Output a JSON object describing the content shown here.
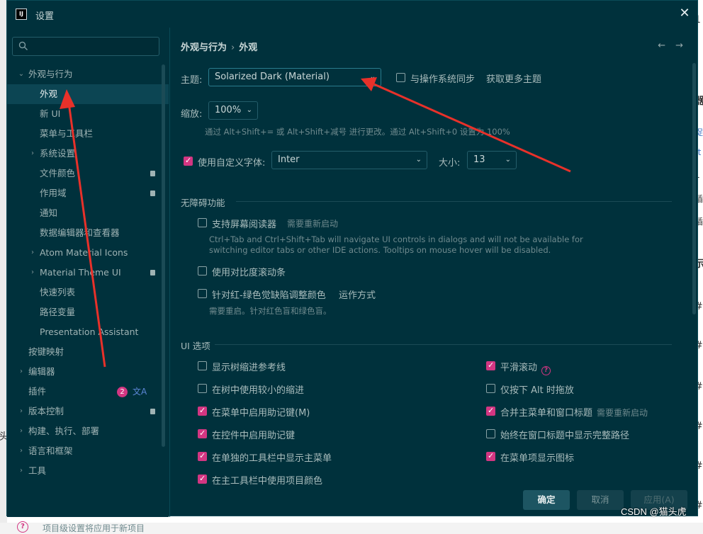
{
  "window": {
    "title": "设置",
    "app_icon_text": "IJ"
  },
  "search": {
    "placeholder": "",
    "icon": "search-icon"
  },
  "sidebar": {
    "items": [
      {
        "label": "外观与行为",
        "level": 0,
        "chevron": "expanded"
      },
      {
        "label": "外观",
        "level": 1,
        "selected": true
      },
      {
        "label": "新 UI",
        "level": 1
      },
      {
        "label": "菜单与工具栏",
        "level": 1
      },
      {
        "label": "系统设置",
        "level": 1,
        "chevron": "collapsed"
      },
      {
        "label": "文件颜色",
        "level": 1,
        "project_icon": true
      },
      {
        "label": "作用域",
        "level": 1,
        "project_icon": true
      },
      {
        "label": "通知",
        "level": 1
      },
      {
        "label": "数据编辑器和查看器",
        "level": 1
      },
      {
        "label": "Atom Material Icons",
        "level": 1,
        "chevron": "collapsed"
      },
      {
        "label": "Material Theme UI",
        "level": 1,
        "chevron": "collapsed",
        "project_icon": true
      },
      {
        "label": "快速列表",
        "level": 1
      },
      {
        "label": "路径变量",
        "level": 1
      },
      {
        "label": "Presentation Assistant",
        "level": 1
      },
      {
        "label": "按键映射",
        "level": 0
      },
      {
        "label": "编辑器",
        "level": 0,
        "chevron": "collapsed"
      },
      {
        "label": "插件",
        "level": 0,
        "badge": "2",
        "translate_icon": "文A"
      },
      {
        "label": "版本控制",
        "level": 0,
        "chevron": "collapsed",
        "project_icon": true
      },
      {
        "label": "构建、执行、部署",
        "level": 0,
        "chevron": "collapsed"
      },
      {
        "label": "语言和框架",
        "level": 0,
        "chevron": "collapsed"
      },
      {
        "label": "工具",
        "level": 0,
        "chevron": "collapsed"
      }
    ],
    "bottom_hint": "项目级设置将应用于新项目",
    "help_glyph": "?"
  },
  "breadcrumb": {
    "parent": "外观与行为",
    "separator": "›",
    "current": "外观"
  },
  "nav": {
    "back": "←",
    "forward": "→"
  },
  "theme": {
    "label": "主题:",
    "value": "Solarized Dark (Material)",
    "sync_label": "与操作系统同步",
    "sync_checked": false,
    "more_link": "获取更多主题"
  },
  "zoom": {
    "label": "缩放:",
    "value": "100%",
    "hint": "通过 Alt+Shift+= 或 Alt+Shift+减号 进行更改。通过 Alt+Shift+0 设置为 100%"
  },
  "font": {
    "custom_label": "使用自定义字体:",
    "custom_checked": true,
    "value": "Inter",
    "size_label": "大小:",
    "size_value": "13"
  },
  "accessibility": {
    "title": "无障碍功能",
    "screen_reader_label": "支持屏幕阅读器",
    "screen_reader_note": "需要重新启动",
    "screen_reader_hint_1": "Ctrl+Tab and Ctrl+Shift+Tab will navigate UI controls in dialogs and will not be available for",
    "screen_reader_hint_2": "switching editor tabs or other IDE actions. Tooltips on mouse hover will be disabled.",
    "contrast_scrollbar_label": "使用对比度滚动条",
    "color_deficiency_label": "针对红-绿色觉缺陷调整颜色",
    "color_deficiency_link": "运作方式",
    "color_deficiency_hint": "需要重启。针对红色盲和绿色盲。"
  },
  "ui_options": {
    "title": "UI 选项",
    "left": [
      {
        "label": "显示树缩进参考线",
        "checked": false
      },
      {
        "label": "在树中使用较小的缩进",
        "checked": false
      },
      {
        "label": "在菜单中启用助记键(M)",
        "checked": true
      },
      {
        "label": "在控件中启用助记键",
        "checked": true
      },
      {
        "label": "在单独的工具栏中显示主菜单",
        "checked": true
      },
      {
        "label": "在主工具栏中使用项目颜色",
        "checked": true
      }
    ],
    "right": [
      {
        "label": "平滑滚动",
        "checked": true,
        "help": "?"
      },
      {
        "label": "仅按下 Alt 时拖放",
        "checked": false
      },
      {
        "label": "合并主菜单和窗口标题",
        "checked": true,
        "note": "需要重新启动"
      },
      {
        "label": "始终在窗口标题中显示完整路径",
        "checked": false
      },
      {
        "label": "在菜单项显示图标",
        "checked": true
      }
    ]
  },
  "buttons": {
    "ok": "确定",
    "cancel": "取消",
    "apply": "应用(A)"
  },
  "watermark": "CSDN @猫头虎",
  "background_fragments": {
    "left": "头",
    "right_top": "1",
    "right_list": [
      "器",
      "捉",
      "(t",
      "L",
      "插",
      "插",
      "示",
      "#",
      "#",
      "#",
      "#",
      "#",
      "#"
    ]
  },
  "colors": {
    "dialog_bg": "#00313c",
    "accent": "#d33682",
    "annotation": "#e8312a"
  }
}
